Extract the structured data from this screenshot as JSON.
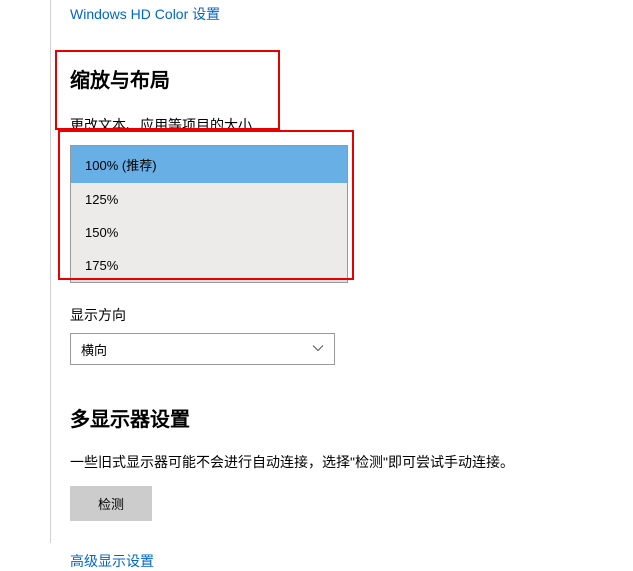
{
  "hdcolor_link": "Windows HD Color 设置",
  "scale_section_title": "缩放与布局",
  "scale_label": "更改文本、应用等项目的大小",
  "scale_options": {
    "opt0": "100% (推荐)",
    "opt1": "125%",
    "opt2": "150%",
    "opt3": "175%"
  },
  "orientation_label": "显示方向",
  "orientation_value": "横向",
  "multimonitor_title": "多显示器设置",
  "multimonitor_desc": "一些旧式显示器可能不会进行自动连接，选择\"检测\"即可尝试手动连接。",
  "detect_button": "检测",
  "advanced_link": "高级显示设置"
}
